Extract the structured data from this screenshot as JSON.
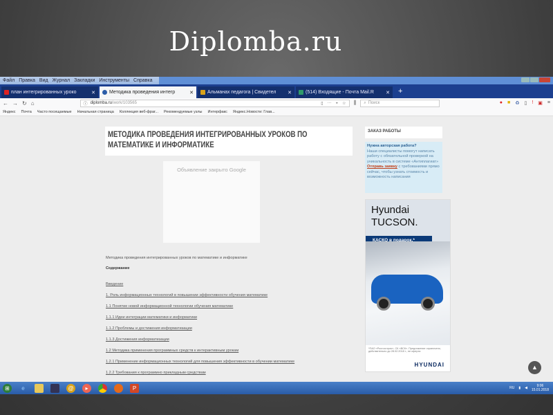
{
  "slide": {
    "title": "Diplomba.ru"
  },
  "browser": {
    "menu": [
      "Файл",
      "Правка",
      "Вид",
      "Журнал",
      "Закладки",
      "Инструменты",
      "Справка"
    ],
    "tabs": [
      {
        "label": "план интегрированных уроко",
        "color": "#d22",
        "active": false
      },
      {
        "label": "Методика проведения интегр",
        "color": "#2a5ca8",
        "active": true
      },
      {
        "label": "Альманах педагога | Свидетел",
        "color": "#d9a21a",
        "active": false
      },
      {
        "label": "(514) Входящие - Почта Mail.R",
        "color": "#2f9a6a",
        "active": false
      }
    ],
    "url_host": "diplomba.ru",
    "url_path": "/work/103565",
    "search_placeholder": "Поиск",
    "bookmarks": [
      "Яндекс",
      "Почта",
      "Часто посещаемые",
      "Начальная страница",
      "Коллекция веб-фраг...",
      "Рекомендуемые узлы",
      "Интерфакс",
      "Яндекс.Новости: Глав..."
    ]
  },
  "page": {
    "heading": "МЕТОДИКА ПРОВЕДЕНИЯ ИНТЕГРИРОВАННЫХ УРОКОВ ПО МАТЕМАТИКЕ И ИНФОРМАТИКЕ",
    "ad_closed": "Объявление закрыто Google",
    "intro": "Методика проведения интегрированных уроков по математике и информатике",
    "contents_label": "Содержание",
    "toc": [
      "Введение",
      "1. Роль информационных технологий в повышении эффективности обучения математике",
      "1.1 Понятие новой информационной технологии обучения математике",
      "1.1.1 Идеи интеграции математики и информатики",
      "1.1.2 Проблемы и достижения информатизации",
      "1.1.3 Достижения информатизации",
      "1.2 Методика применения программных средств к интерактивным урокам",
      "1.2.1 Применение информационных технологий для повышения эффективности в обучении математике",
      "1.2.2 Требования к программно прикладным средствам"
    ],
    "sidebar": {
      "order_title": "ЗАКАЗ РАБОТЫ",
      "info_title": "Нужна авторская работа?",
      "info_text": "Наши специалисты помогут написать работу с обязательной проверкой на уникальность в системе «Антиплагиат»",
      "info_link": "Отправь заявку",
      "info_text2": "с требованиями прямо сейчас, чтобы узнать стоимость и возможность написания"
    },
    "ad": {
      "line1": "Hyundai",
      "line2": "TUCSON.",
      "band": "КАСКО в подарок.*",
      "note": "*ПАО «Росгосстрах», СК «ВСК». Предложение ограничено, действительно до 28.02.2018 г., не оферта",
      "brand": "HYUNDAI"
    }
  },
  "taskbar": {
    "lang": "RU",
    "time": "9:06",
    "date": "15.01.2018"
  }
}
